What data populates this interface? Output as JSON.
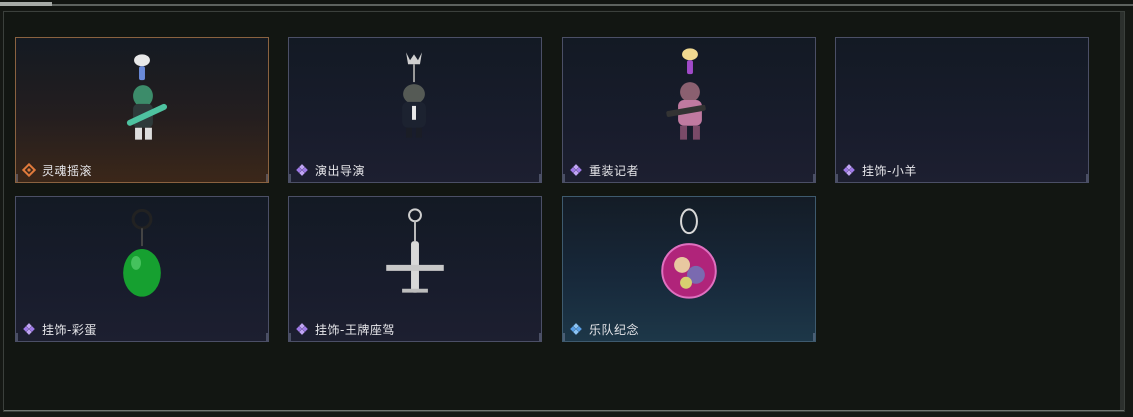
{
  "colors": {
    "rarity_legendary": "#e07a3c",
    "rarity_epic": "#a07ae8",
    "rarity_rare": "#5aa0e8"
  },
  "items": [
    {
      "name": "灵魂摇滚",
      "rarity": "legendary",
      "icon": "rocker-guitarist-charm"
    },
    {
      "name": "演出导演",
      "rarity": "epic",
      "icon": "director-figure-charm"
    },
    {
      "name": "重装记者",
      "rarity": "epic",
      "icon": "heavy-reporter-charm"
    },
    {
      "name": "挂饰-小羊",
      "rarity": "epic",
      "icon": "empty-charm"
    },
    {
      "name": "挂饰-彩蛋",
      "rarity": "epic",
      "icon": "green-egg-charm"
    },
    {
      "name": "挂饰-王牌座驾",
      "rarity": "epic",
      "icon": "jet-plane-charm"
    },
    {
      "name": "乐队纪念",
      "rarity": "rare",
      "icon": "band-badge-charm"
    }
  ]
}
